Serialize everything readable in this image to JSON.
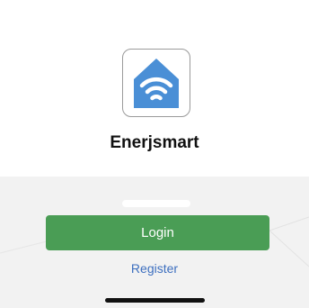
{
  "app": {
    "name": "Enerjsmart",
    "icon": "house-wifi-icon"
  },
  "actions": {
    "login_label": "Login",
    "register_label": "Register"
  },
  "colors": {
    "primary_button": "#4a9d55",
    "link": "#3d6fbf",
    "icon_blue": "#4a8fd6",
    "background_bottom": "#f2f2f2"
  }
}
